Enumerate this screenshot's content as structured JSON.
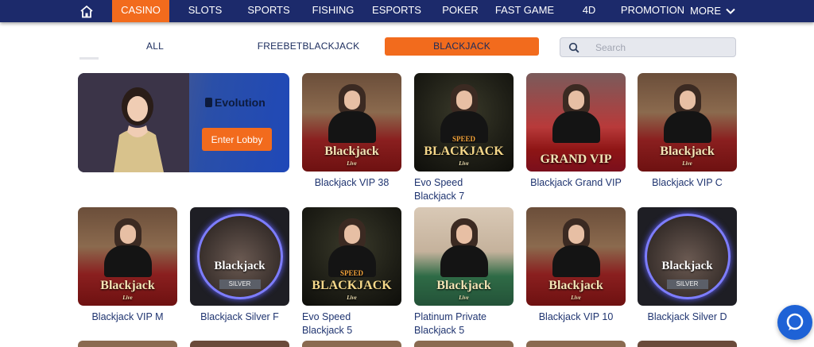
{
  "nav": {
    "home_icon": "home-icon",
    "items": [
      {
        "label": "CASINO",
        "active": true
      },
      {
        "label": "SLOTS"
      },
      {
        "label": "SPORTS"
      },
      {
        "label": "FISHING"
      },
      {
        "label": "ESPORTS"
      },
      {
        "label": "POKER"
      },
      {
        "label": "FAST GAME"
      },
      {
        "label": "4D"
      },
      {
        "label": "PROMOTION"
      },
      {
        "label": "MORE",
        "icon": "chevron-down-icon"
      }
    ]
  },
  "subtabs": [
    {
      "label": "ALL"
    },
    {
      "label": "FREEBETBLACKJACK"
    },
    {
      "label": "BLACKJACK",
      "active": true
    }
  ],
  "search": {
    "placeholder": "Search",
    "icon": "search-icon"
  },
  "banner": {
    "provider": "Evolution",
    "button_label": "Enter Lobby"
  },
  "games": [
    {
      "title": "Blackjack VIP 38",
      "logo": "Blackjack",
      "sub": "Live",
      "style": "red"
    },
    {
      "title": "Evo Speed Blackjack 7",
      "logo": "BLACKJACK",
      "sub": "Live",
      "prefix": "SPEED",
      "style": "speed"
    },
    {
      "title": "Blackjack Grand VIP",
      "logo": "GRAND VIP",
      "style": "grand"
    },
    {
      "title": "Blackjack VIP C",
      "logo": "Blackjack",
      "sub": "Live",
      "style": "red"
    },
    {
      "title": "Blackjack VIP M",
      "logo": "Blackjack",
      "sub": "Live",
      "style": "red"
    },
    {
      "title": "Blackjack Silver F",
      "logo": "Blackjack",
      "sub": "Live",
      "badge": "SILVER",
      "style": "silver"
    },
    {
      "title": "Evo Speed Blackjack 5",
      "logo": "BLACKJACK",
      "sub": "Live",
      "prefix": "SPEED",
      "style": "speed"
    },
    {
      "title": "Platinum Private Blackjack 5",
      "logo": "Blackjack",
      "sub": "Live",
      "style": "private"
    },
    {
      "title": "Blackjack VIP 10",
      "logo": "Blackjack",
      "sub": "Live",
      "style": "red"
    },
    {
      "title": "Blackjack Silver D",
      "logo": "Blackjack",
      "sub": "Live",
      "badge": "SILVER",
      "style": "silver"
    }
  ],
  "colors": {
    "nav_bg": "#1c2a6b",
    "accent": "#f26b1d",
    "chat": "#1e62d6"
  },
  "chat_icon": "chat-bubble-icon"
}
